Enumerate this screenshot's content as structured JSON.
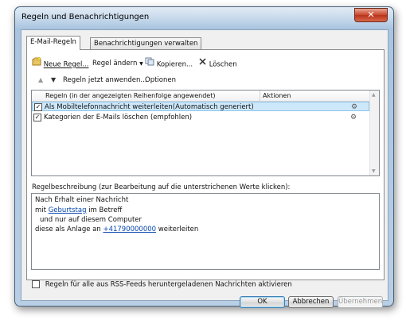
{
  "window": {
    "title": "Regeln und Benachrichtigungen",
    "close_label": "✕"
  },
  "tabs": [
    {
      "label": "E-Mail-Regeln",
      "active": true
    },
    {
      "label": "Benachrichtigungen verwalten",
      "active": false
    }
  ],
  "toolbar": {
    "new_rule": "Neue Regel...",
    "change_rule": "Regel ändern",
    "copy": "Kopieren...",
    "delete": "Löschen",
    "move_up": "▲",
    "move_down": "▼",
    "apply_now": "Regeln jetzt anwenden...",
    "options": "Optionen"
  },
  "rules_list": {
    "columns": [
      "Regeln (in der angezeigten Reihenfolge angewendet)",
      "Aktionen"
    ],
    "rows": [
      {
        "checked": true,
        "selected": true,
        "label": "Als Mobiltelefonnachricht weiterleiten(Automatisch generiert)"
      },
      {
        "checked": true,
        "selected": false,
        "label": "Kategorien der E-Mails löschen (empfohlen)"
      }
    ]
  },
  "description": {
    "label": "Regelbeschreibung (zur Bearbeitung auf die unterstrichenen Werte klicken):",
    "line1": "Nach Erhalt einer Nachricht",
    "line2_prefix": "mit",
    "line2_link": "Geburtstag",
    "line2_suffix": "im Betreff",
    "line3": "und nur auf diesem Computer",
    "line4_prefix": "diese als Anlage an",
    "line4_link": "+41790000000",
    "line4_suffix": "weiterleiten"
  },
  "rss_checkbox": {
    "label": "Regeln für alle aus RSS-Feeds heruntergeladenen Nachrichten aktivieren",
    "checked": false
  },
  "buttons": {
    "ok": "OK",
    "cancel": "Abbrechen",
    "apply": "Übernehmen"
  }
}
